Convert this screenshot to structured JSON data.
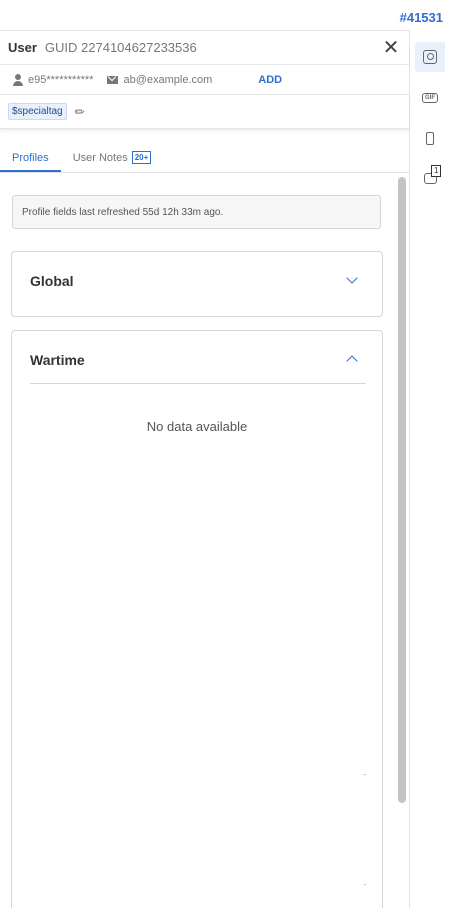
{
  "ticket_id": "#41531",
  "header": {
    "title": "User",
    "guid": "GUID 2274104627233536",
    "close": "✕"
  },
  "contact": {
    "phone": "e95***********",
    "email": "ab@example.com",
    "add_label": "ADD"
  },
  "tag": {
    "label": "$specialtag",
    "edit_icon": "✎"
  },
  "tabs": [
    {
      "label": "Profiles"
    },
    {
      "label": "User Notes",
      "badge": "20+"
    }
  ],
  "refresh_notice": "Profile fields last refreshed 55d 12h 33m ago.",
  "sections": {
    "global": {
      "title": "Global"
    },
    "wartime": {
      "title": "Wartime",
      "empty_text": "No data available"
    }
  },
  "rail": {
    "icons": [
      "user-profile-icon",
      "gif-icon",
      "phone-touch-icon",
      "chat-icon"
    ],
    "chat_count": "1"
  },
  "colors": {
    "accent": "#2f6fd0"
  }
}
